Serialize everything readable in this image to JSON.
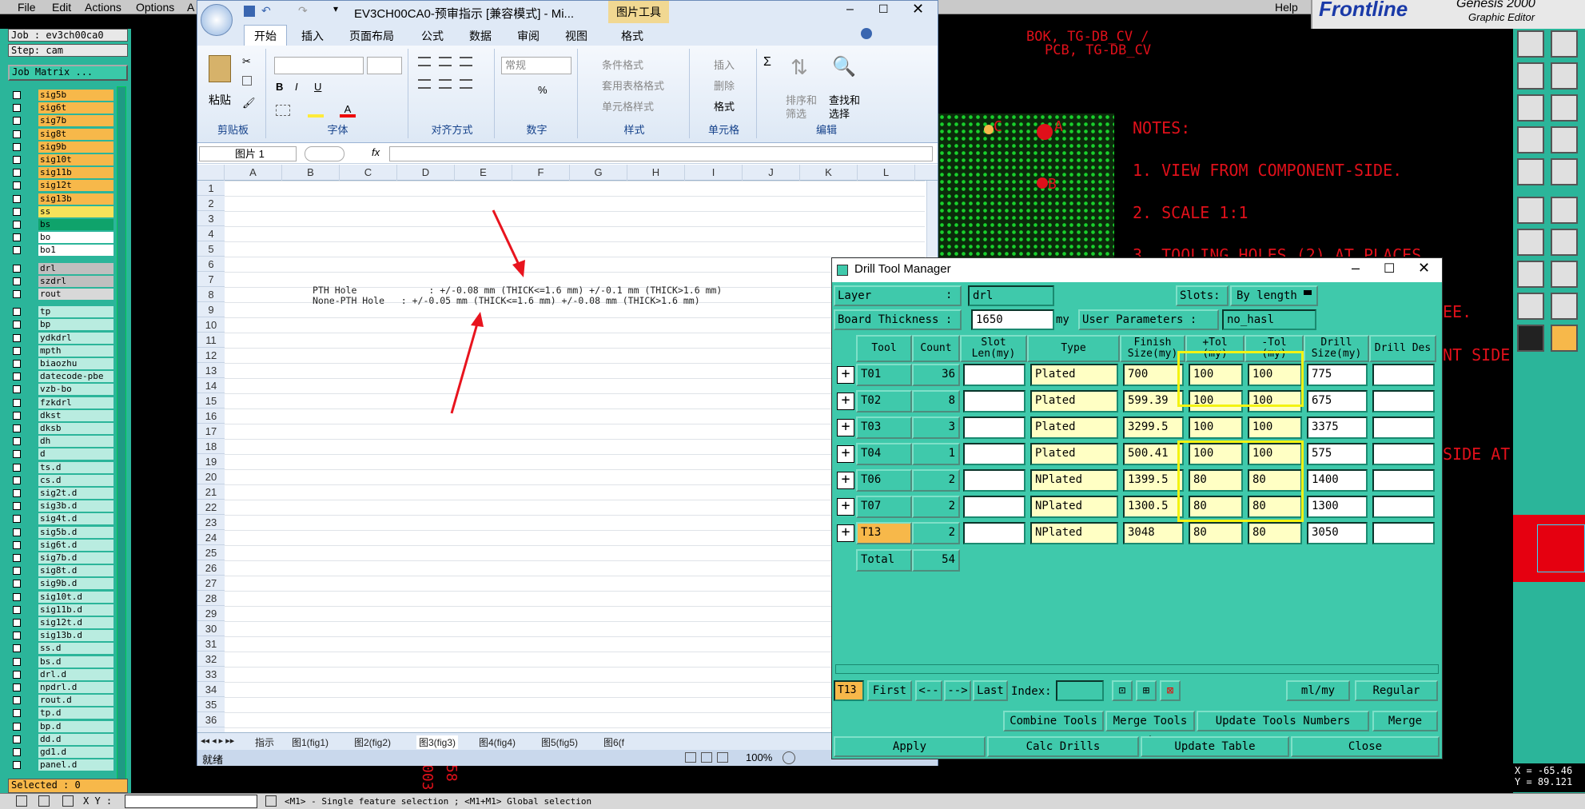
{
  "genesis": {
    "menu": [
      "File",
      "Edit",
      "Actions",
      "Options",
      "A"
    ],
    "help": "Help",
    "brand": "Frontline",
    "product_top": "Genesis 2000",
    "product_sub": "Graphic Editor",
    "job_label": "Job : ev3ch00ca0",
    "step_label": "Step: cam",
    "job_matrix": "Job Matrix ...",
    "layers": [
      "sig5b",
      "sig6t",
      "sig7b",
      "sig8t",
      "sig9b",
      "sig10t",
      "sig11b",
      "sig12t",
      "sig13b",
      "ss",
      "bs",
      "bo",
      "bo1",
      "drl",
      "szdrl",
      "rout",
      "tp",
      "bp",
      "ydkdrl",
      "mpth",
      "biaozhu",
      "datecode-pbe",
      "vzb-bo",
      "fzkdrl",
      "dkst",
      "dksb",
      "dh",
      "d",
      "ts.d",
      "cs.d",
      "sig2t.d",
      "sig3b.d",
      "sig4t.d",
      "sig5b.d",
      "sig6t.d",
      "sig7b.d",
      "sig8t.d",
      "sig9b.d",
      "sig10t.d",
      "sig11b.d",
      "sig12t.d",
      "sig13b.d",
      "ss.d",
      "bs.d",
      "drl.d",
      "npdrl.d",
      "rout.d",
      "tp.d",
      "bp.d",
      "dd.d",
      "gd1.d",
      "panel.d"
    ],
    "selected": "Selected : 0",
    "canvas_title_1": "BOK, TG-DB_CV /",
    "canvas_title_2": "PCB, TG-DB_CV",
    "notes": [
      "NOTES:",
      "1.   VIEW FROM COMPONENT-SIDE.",
      "2.   SCALE 1:1",
      "3.   TOOLING HOLES (2) AT   PLACES."
    ],
    "notes_frag": [
      "EE.",
      "NT SIDE",
      "SIDE AT"
    ],
    "markers": [
      "A",
      "B",
      "C"
    ],
    "coord_x": "X = -65.46",
    "coord_y": "Y = 89.121",
    "status_line": "<M1> - Single feature selection ; <M1+M1> Global selection",
    "xy_label": "X Y :",
    "canvas_vert": [
      "003",
      "58"
    ],
    "colors": {
      "teal": "#2bb59a",
      "red": "#e0101a",
      "orange": "#f7b84a",
      "green": "#0fa36b"
    }
  },
  "excel": {
    "title": "EV3CH00CA0-预审指示  [兼容模式] - Mi...",
    "pic_tools": "图片工具",
    "tabs": [
      "开始",
      "插入",
      "页面布局",
      "公式",
      "数据",
      "审阅",
      "视图",
      "格式"
    ],
    "groups": {
      "clipboard": {
        "label": "剪贴板",
        "paste": "粘贴"
      },
      "font": {
        "label": "字体"
      },
      "align": {
        "label": "对齐方式"
      },
      "number": {
        "label": "数字",
        "format": "常规"
      },
      "style": {
        "label": "样式",
        "items": [
          "条件格式",
          "套用表格格式",
          "单元格样式"
        ]
      },
      "cells": {
        "label": "单元格",
        "items": [
          "插入",
          "删除",
          "格式"
        ]
      },
      "edit": {
        "label": "编辑",
        "sort": "排序和筛选",
        "find": "查找和选择"
      }
    },
    "name_box": "图片 1",
    "fx": "fx",
    "columns": [
      "A",
      "B",
      "C",
      "D",
      "E",
      "F",
      "G",
      "H",
      "I",
      "J",
      "K",
      "L"
    ],
    "rows": [
      "1",
      "2",
      "3",
      "4",
      "5",
      "6",
      "7",
      "8",
      "9",
      "10",
      "11",
      "12",
      "13",
      "14",
      "15",
      "16",
      "17",
      "18",
      "19",
      "20",
      "21",
      "22",
      "23",
      "24",
      "25",
      "26",
      "27",
      "28",
      "29",
      "30",
      "31",
      "32",
      "33",
      "34",
      "35",
      "36"
    ],
    "pth_line": "PTH Hole             : +/-0.08 mm (THICK<=1.6 mm) +/-0.1 mm (THICK>1.6 mm)",
    "npth_line": "None-PTH Hole   : +/-0.05 mm (THICK<=1.6 mm) +/-0.08 mm (THICK>1.6 mm)",
    "sheet_tabs": [
      "指示",
      "图1(fig1)",
      "图2(fig2)",
      "图3(fig3)",
      "图4(fig4)",
      "图5(fig5)",
      "图6(f"
    ],
    "status_ready": "就绪",
    "zoom": "100%"
  },
  "dtm": {
    "title": "Drill Tool Manager",
    "layer_label": "Layer",
    "layer_value": "drl",
    "slots_label": "Slots:",
    "slots_value": "By length",
    "board_thk_label": "Board Thickness :",
    "board_thk_value": "1650",
    "board_thk_unit": "my",
    "user_params_label": "User Parameters :",
    "user_params_value": "no_hasl",
    "headers": [
      "Tool",
      "Count",
      "Slot Len(my)",
      "Type",
      "Finish Size(my)",
      "+Tol (my)",
      "-Tol (my)",
      "Drill Size(my)",
      "Drill Des"
    ],
    "rows": [
      {
        "tool": "T01",
        "count": "36",
        "type": "Plated",
        "finish": "700",
        "ptol": "100",
        "mtol": "100",
        "drill": "775"
      },
      {
        "tool": "T02",
        "count": "8",
        "type": "Plated",
        "finish": "599.39",
        "ptol": "100",
        "mtol": "100",
        "drill": "675"
      },
      {
        "tool": "T03",
        "count": "3",
        "type": "Plated",
        "finish": "3299.5",
        "ptol": "100",
        "mtol": "100",
        "drill": "3375"
      },
      {
        "tool": "T04",
        "count": "1",
        "type": "Plated",
        "finish": "500.41",
        "ptol": "100",
        "mtol": "100",
        "drill": "575"
      },
      {
        "tool": "T06",
        "count": "2",
        "type": "NPlated",
        "finish": "1399.5",
        "ptol": "80",
        "mtol": "80",
        "drill": "1400"
      },
      {
        "tool": "T07",
        "count": "2",
        "type": "NPlated",
        "finish": "1300.5",
        "ptol": "80",
        "mtol": "80",
        "drill": "1300"
      },
      {
        "tool": "T13",
        "count": "2",
        "type": "NPlated",
        "finish": "3048",
        "ptol": "80",
        "mtol": "80",
        "drill": "3050"
      }
    ],
    "total_label": "Total",
    "total_count": "54",
    "current_tool": "T13",
    "nav": [
      "First",
      "<--",
      "-->",
      "Last"
    ],
    "index_label": "Index:",
    "units": "ml/my",
    "mode": "Regular",
    "combine": "Combine Tools",
    "merge_label": "Merge Tools :",
    "update_numbers": "Update Tools Numbers",
    "merge": "Merge",
    "apply": "Apply",
    "calc": "Calc Drills",
    "update_table": "Update Table",
    "close": "Close"
  }
}
